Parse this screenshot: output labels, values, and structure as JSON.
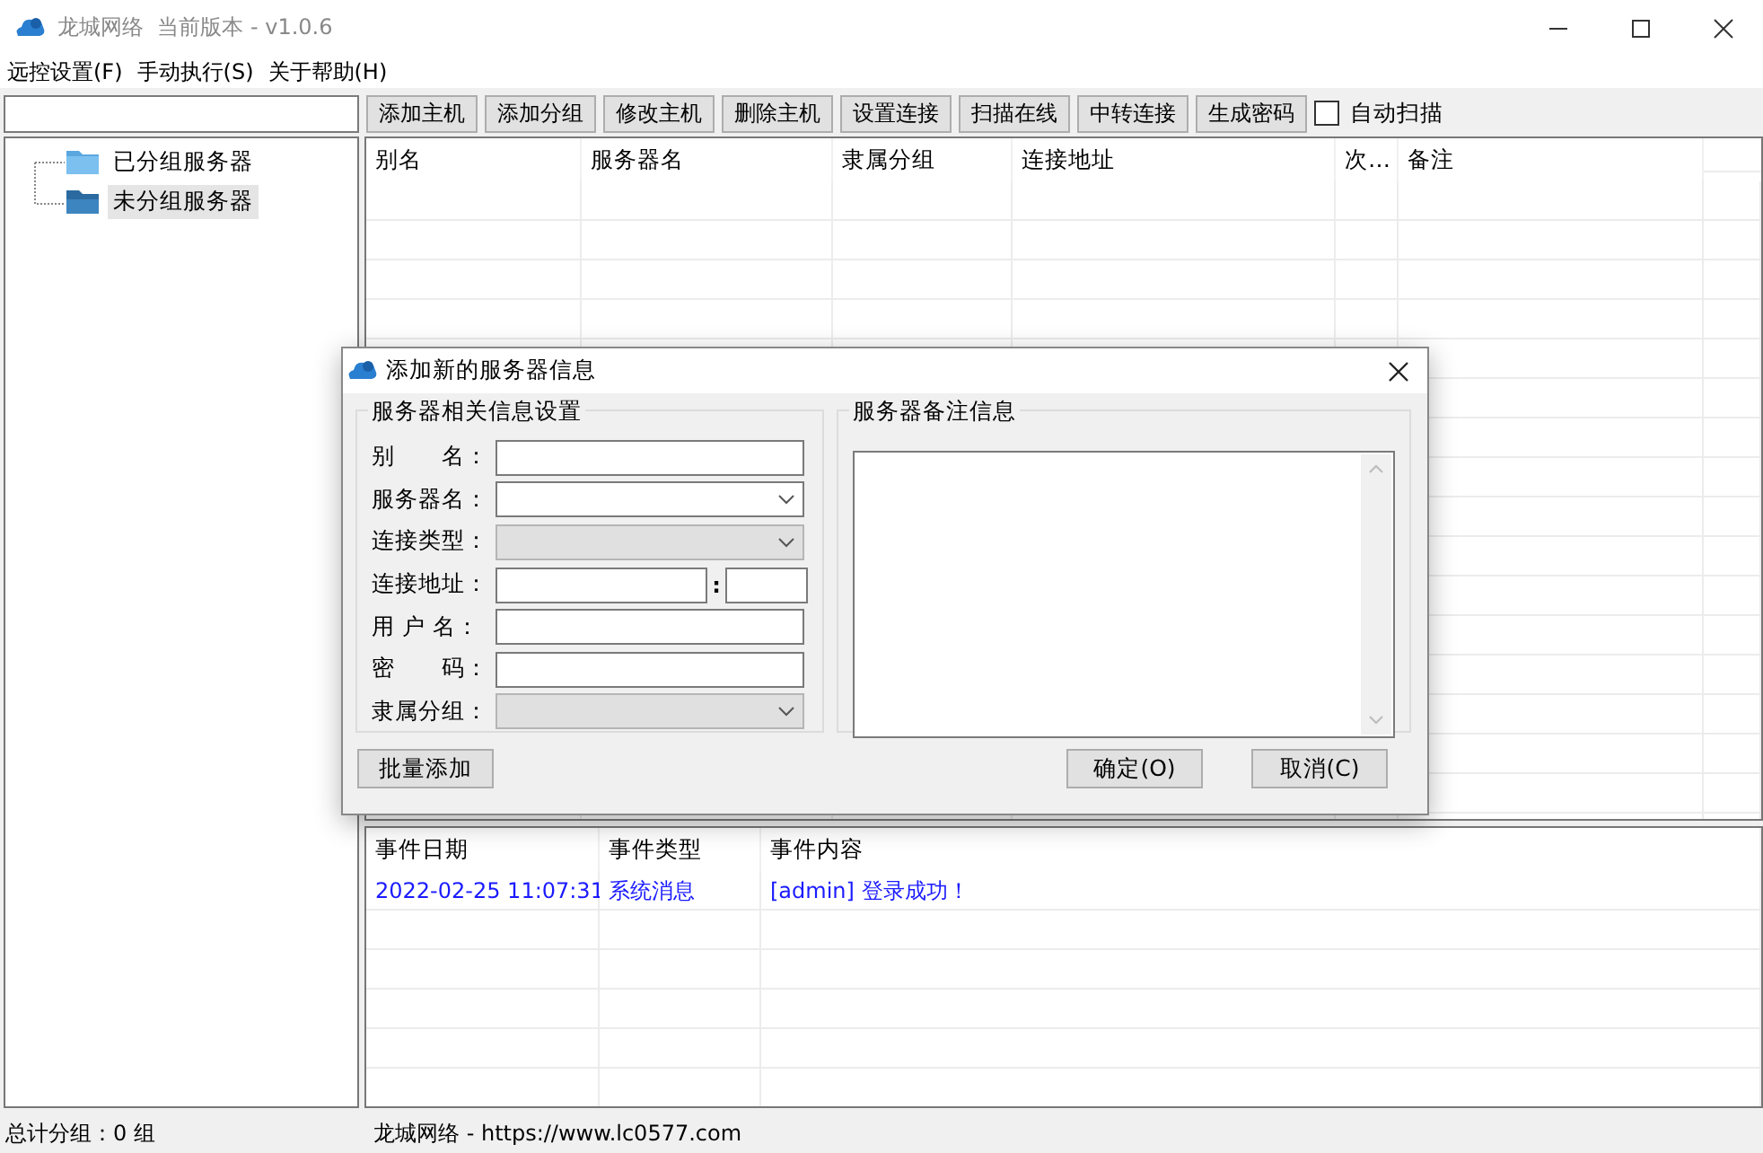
{
  "window": {
    "title": "龙城网络  当前版本 - v1.0.6"
  },
  "menu": [
    "远控设置(F)",
    "手动执行(S)",
    "关于帮助(H)"
  ],
  "toolbar": {
    "buttons": [
      "添加主机",
      "添加分组",
      "修改主机",
      "删除主机",
      "设置连接",
      "扫描在线",
      "中转连接",
      "生成密码"
    ],
    "auto_scan": {
      "label": "自动扫描",
      "checked": false
    }
  },
  "tree": [
    {
      "label": "已分组服务器",
      "selected": false,
      "expanded": false
    },
    {
      "label": "未分组服务器",
      "selected": true,
      "expanded": true
    }
  ],
  "host_table": {
    "columns": [
      "别名",
      "服务器名",
      "隶属分组",
      "连接地址",
      "次…",
      "备注"
    ]
  },
  "dialog": {
    "title": "添加新的服务器信息",
    "settings_group": "服务器相关信息设置",
    "notes_group": "服务器备注信息",
    "fields": [
      {
        "label": "别　　名：",
        "kind": "text",
        "disabled": false
      },
      {
        "label": "服务器名：",
        "kind": "combo",
        "disabled": false
      },
      {
        "label": "连接类型：",
        "kind": "combo",
        "disabled": true
      },
      {
        "label": "连接地址：",
        "kind": "address",
        "disabled": false,
        "separator": ":"
      },
      {
        "label": "用 户 名：",
        "kind": "text",
        "disabled": false
      },
      {
        "label": "密　　码：",
        "kind": "text",
        "disabled": false
      },
      {
        "label": "隶属分组：",
        "kind": "combo",
        "disabled": true
      }
    ],
    "batch_button": "批量添加",
    "ok_button": "确定(O)",
    "cancel_button": "取消(C)"
  },
  "event_table": {
    "columns": [
      "事件日期",
      "事件类型",
      "事件内容"
    ],
    "rows": [
      [
        "2022-02-25 11:07:31",
        "系统消息",
        "[admin] 登录成功！"
      ]
    ]
  },
  "status_bar": {
    "left": "总计分组：0 组",
    "right": "龙城网络 - https://www.lc0577.com"
  }
}
